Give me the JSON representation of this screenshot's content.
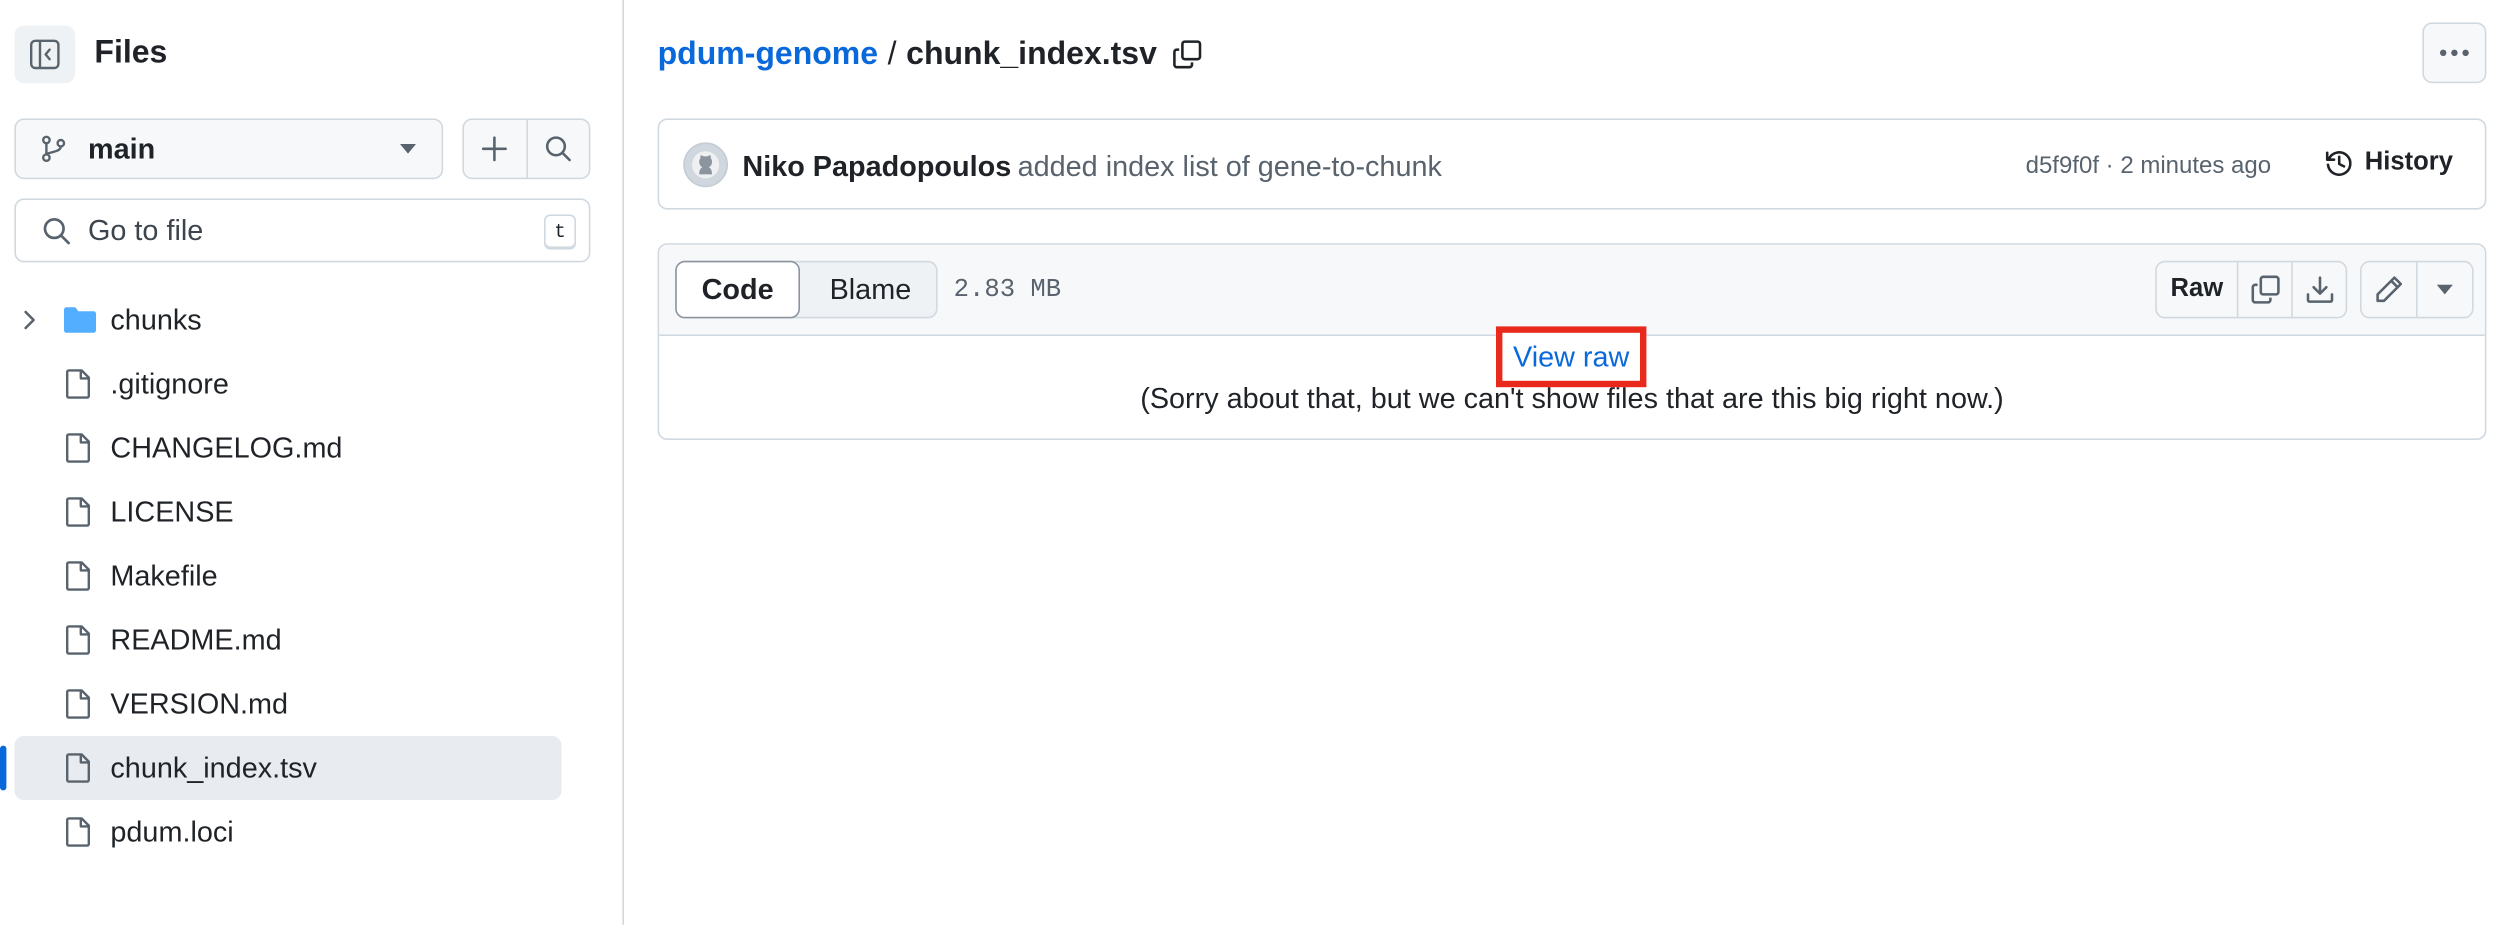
{
  "sidebar": {
    "title": "Files",
    "branch": "main",
    "search_placeholder": "Go to file",
    "shortcut_key": "t",
    "tree": [
      {
        "name": "chunks",
        "type": "folder"
      },
      {
        "name": ".gitignore",
        "type": "file"
      },
      {
        "name": "CHANGELOG.md",
        "type": "file"
      },
      {
        "name": "LICENSE",
        "type": "file"
      },
      {
        "name": "Makefile",
        "type": "file"
      },
      {
        "name": "README.md",
        "type": "file"
      },
      {
        "name": "VERSION.md",
        "type": "file"
      },
      {
        "name": "chunk_index.tsv",
        "type": "file",
        "active": true
      },
      {
        "name": "pdum.loci",
        "type": "file"
      }
    ]
  },
  "breadcrumb": {
    "repo": "pdum-genome",
    "separator": "/",
    "file": "chunk_index.tsv"
  },
  "commit": {
    "author": "Niko Papadopoulos",
    "message": "added index list of gene-to-chunk",
    "meta": "d5f9f0f · 2 minutes ago",
    "history_label": "History"
  },
  "file": {
    "tabs": {
      "code": "Code",
      "blame": "Blame"
    },
    "size": "2.83 MB",
    "raw_label": "Raw",
    "view_raw": "View raw",
    "notice": "(Sorry about that, but we can't show files that are this big right now.)"
  },
  "colors": {
    "accent": "#0969da",
    "highlight": "#e8291b"
  }
}
